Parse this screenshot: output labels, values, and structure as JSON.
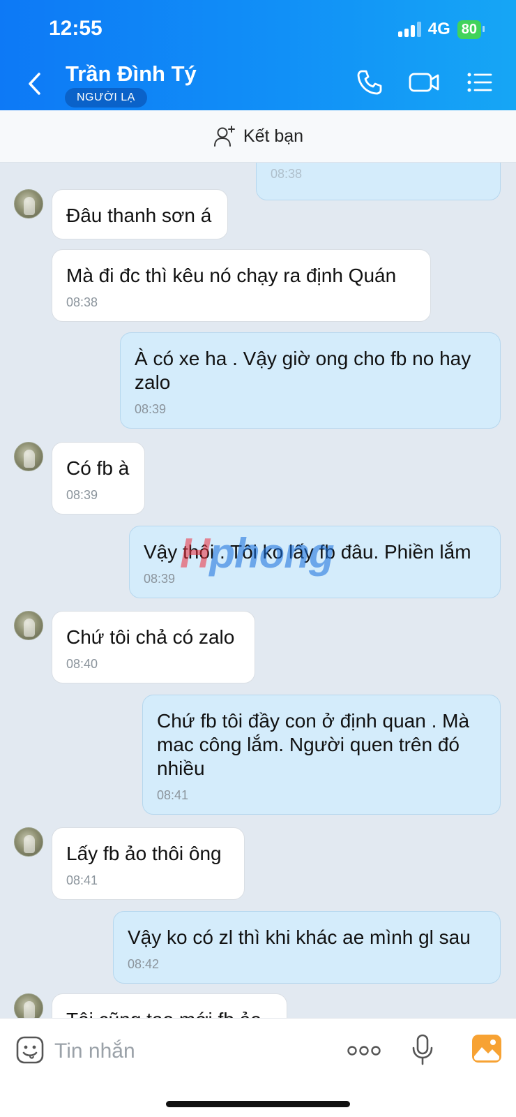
{
  "status_bar": {
    "time": "12:55",
    "network": "4G",
    "battery": "80"
  },
  "header": {
    "contact_name": "Trần Đình Tý",
    "badge": "NGƯỜI LẠ"
  },
  "friend_bar": {
    "label": "Kết bạn"
  },
  "messages": [
    {
      "dir": "out",
      "text": "",
      "time": "08:38"
    },
    {
      "dir": "in",
      "text": "Đâu thanh sơn á",
      "time": ""
    },
    {
      "dir": "in",
      "text": "Mà đi đc thì kêu nó chạy ra định Quán",
      "time": "08:38"
    },
    {
      "dir": "out",
      "text": "À có xe ha . Vậy giờ ong cho fb no hay zalo",
      "time": "08:39"
    },
    {
      "dir": "in",
      "text": "Có fb à",
      "time": "08:39"
    },
    {
      "dir": "out",
      "text": "Vậy thôi . Tôi ko lấy fb đâu. Phiền lắm",
      "time": "08:39"
    },
    {
      "dir": "in",
      "text": "Chứ tôi chả có zalo",
      "time": "08:40"
    },
    {
      "dir": "out",
      "text": "Chứ fb tôi đầy con ở định quan . Mà mac công lắm. Người quen trên đó nhiều",
      "time": "08:41"
    },
    {
      "dir": "in",
      "text": "Lấy fb ảo thôi ông",
      "time": "08:41"
    },
    {
      "dir": "out",
      "text": "Vậy ko có zl thì khi khác ae mình gl sau",
      "time": "08:42"
    },
    {
      "dir": "in",
      "text": "Tôi cũng tạo mới fb ảo",
      "time": ""
    }
  ],
  "watermark": {
    "part1": "H",
    "part2": "phong"
  },
  "input": {
    "placeholder": "Tin nhắn"
  },
  "icons": {
    "back": "chevron-left-icon",
    "phone": "phone-icon",
    "video": "video-icon",
    "menu": "list-menu-icon",
    "add_friend": "add-user-icon",
    "emoji": "emoji-icon",
    "more": "more-dots-icon",
    "mic": "microphone-icon",
    "gallery": "image-icon"
  },
  "colors": {
    "header_start": "#0d79f6",
    "header_end": "#16a6f5",
    "outgoing_bubble": "#d4ecfb",
    "incoming_bubble": "#ffffff",
    "chat_bg": "#e2e9f1",
    "badge": "#0a62c9",
    "gallery": "#f7a233"
  }
}
